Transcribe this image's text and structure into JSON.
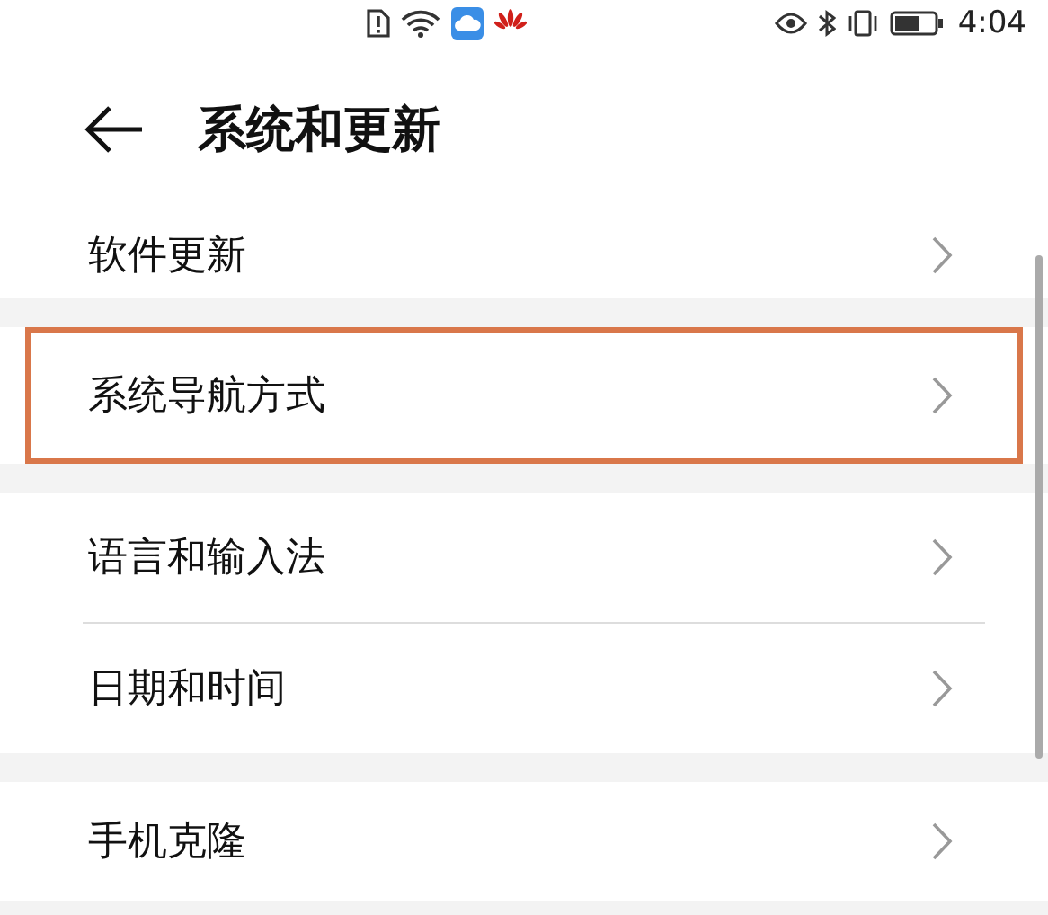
{
  "status_bar": {
    "time": "4:04"
  },
  "header": {
    "title": "系统和更新"
  },
  "groups": [
    {
      "items": [
        {
          "label": "软件更新",
          "highlighted": false
        }
      ]
    },
    {
      "items": [
        {
          "label": "系统导航方式",
          "highlighted": true
        }
      ]
    },
    {
      "items": [
        {
          "label": "语言和输入法",
          "highlighted": false
        },
        {
          "label": "日期和时间",
          "highlighted": false
        }
      ]
    },
    {
      "items": [
        {
          "label": "手机克隆",
          "highlighted": false
        }
      ]
    }
  ]
}
